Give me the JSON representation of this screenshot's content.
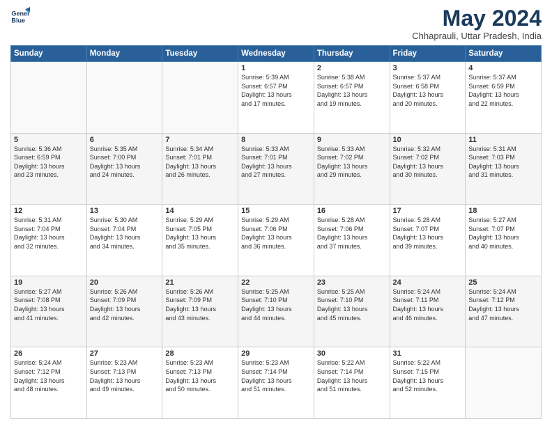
{
  "header": {
    "logo_line1": "General",
    "logo_line2": "Blue",
    "month_year": "May 2024",
    "location": "Chhaprauli, Uttar Pradesh, India"
  },
  "days_of_week": [
    "Sunday",
    "Monday",
    "Tuesday",
    "Wednesday",
    "Thursday",
    "Friday",
    "Saturday"
  ],
  "weeks": [
    [
      {
        "day": "",
        "info": ""
      },
      {
        "day": "",
        "info": ""
      },
      {
        "day": "",
        "info": ""
      },
      {
        "day": "1",
        "info": "Sunrise: 5:39 AM\nSunset: 6:57 PM\nDaylight: 13 hours\nand 17 minutes."
      },
      {
        "day": "2",
        "info": "Sunrise: 5:38 AM\nSunset: 6:57 PM\nDaylight: 13 hours\nand 19 minutes."
      },
      {
        "day": "3",
        "info": "Sunrise: 5:37 AM\nSunset: 6:58 PM\nDaylight: 13 hours\nand 20 minutes."
      },
      {
        "day": "4",
        "info": "Sunrise: 5:37 AM\nSunset: 6:59 PM\nDaylight: 13 hours\nand 22 minutes."
      }
    ],
    [
      {
        "day": "5",
        "info": "Sunrise: 5:36 AM\nSunset: 6:59 PM\nDaylight: 13 hours\nand 23 minutes."
      },
      {
        "day": "6",
        "info": "Sunrise: 5:35 AM\nSunset: 7:00 PM\nDaylight: 13 hours\nand 24 minutes."
      },
      {
        "day": "7",
        "info": "Sunrise: 5:34 AM\nSunset: 7:01 PM\nDaylight: 13 hours\nand 26 minutes."
      },
      {
        "day": "8",
        "info": "Sunrise: 5:33 AM\nSunset: 7:01 PM\nDaylight: 13 hours\nand 27 minutes."
      },
      {
        "day": "9",
        "info": "Sunrise: 5:33 AM\nSunset: 7:02 PM\nDaylight: 13 hours\nand 29 minutes."
      },
      {
        "day": "10",
        "info": "Sunrise: 5:32 AM\nSunset: 7:02 PM\nDaylight: 13 hours\nand 30 minutes."
      },
      {
        "day": "11",
        "info": "Sunrise: 5:31 AM\nSunset: 7:03 PM\nDaylight: 13 hours\nand 31 minutes."
      }
    ],
    [
      {
        "day": "12",
        "info": "Sunrise: 5:31 AM\nSunset: 7:04 PM\nDaylight: 13 hours\nand 32 minutes."
      },
      {
        "day": "13",
        "info": "Sunrise: 5:30 AM\nSunset: 7:04 PM\nDaylight: 13 hours\nand 34 minutes."
      },
      {
        "day": "14",
        "info": "Sunrise: 5:29 AM\nSunset: 7:05 PM\nDaylight: 13 hours\nand 35 minutes."
      },
      {
        "day": "15",
        "info": "Sunrise: 5:29 AM\nSunset: 7:06 PM\nDaylight: 13 hours\nand 36 minutes."
      },
      {
        "day": "16",
        "info": "Sunrise: 5:28 AM\nSunset: 7:06 PM\nDaylight: 13 hours\nand 37 minutes."
      },
      {
        "day": "17",
        "info": "Sunrise: 5:28 AM\nSunset: 7:07 PM\nDaylight: 13 hours\nand 39 minutes."
      },
      {
        "day": "18",
        "info": "Sunrise: 5:27 AM\nSunset: 7:07 PM\nDaylight: 13 hours\nand 40 minutes."
      }
    ],
    [
      {
        "day": "19",
        "info": "Sunrise: 5:27 AM\nSunset: 7:08 PM\nDaylight: 13 hours\nand 41 minutes."
      },
      {
        "day": "20",
        "info": "Sunrise: 5:26 AM\nSunset: 7:09 PM\nDaylight: 13 hours\nand 42 minutes."
      },
      {
        "day": "21",
        "info": "Sunrise: 5:26 AM\nSunset: 7:09 PM\nDaylight: 13 hours\nand 43 minutes."
      },
      {
        "day": "22",
        "info": "Sunrise: 5:25 AM\nSunset: 7:10 PM\nDaylight: 13 hours\nand 44 minutes."
      },
      {
        "day": "23",
        "info": "Sunrise: 5:25 AM\nSunset: 7:10 PM\nDaylight: 13 hours\nand 45 minutes."
      },
      {
        "day": "24",
        "info": "Sunrise: 5:24 AM\nSunset: 7:11 PM\nDaylight: 13 hours\nand 46 minutes."
      },
      {
        "day": "25",
        "info": "Sunrise: 5:24 AM\nSunset: 7:12 PM\nDaylight: 13 hours\nand 47 minutes."
      }
    ],
    [
      {
        "day": "26",
        "info": "Sunrise: 5:24 AM\nSunset: 7:12 PM\nDaylight: 13 hours\nand 48 minutes."
      },
      {
        "day": "27",
        "info": "Sunrise: 5:23 AM\nSunset: 7:13 PM\nDaylight: 13 hours\nand 49 minutes."
      },
      {
        "day": "28",
        "info": "Sunrise: 5:23 AM\nSunset: 7:13 PM\nDaylight: 13 hours\nand 50 minutes."
      },
      {
        "day": "29",
        "info": "Sunrise: 5:23 AM\nSunset: 7:14 PM\nDaylight: 13 hours\nand 51 minutes."
      },
      {
        "day": "30",
        "info": "Sunrise: 5:22 AM\nSunset: 7:14 PM\nDaylight: 13 hours\nand 51 minutes."
      },
      {
        "day": "31",
        "info": "Sunrise: 5:22 AM\nSunset: 7:15 PM\nDaylight: 13 hours\nand 52 minutes."
      },
      {
        "day": "",
        "info": ""
      }
    ]
  ]
}
